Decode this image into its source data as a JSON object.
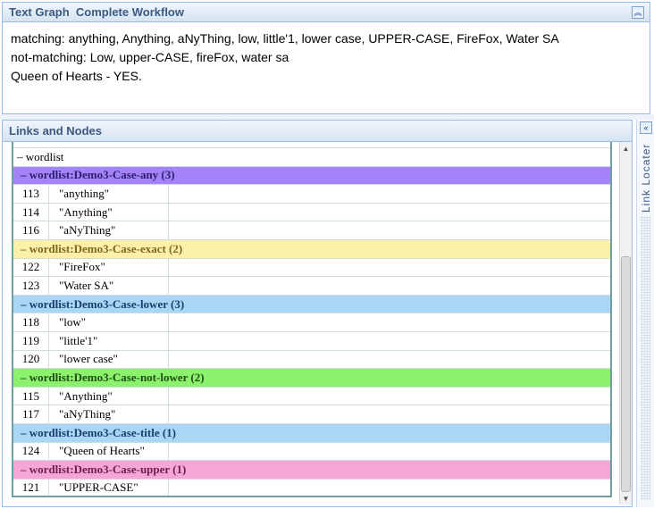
{
  "top_panel": {
    "title": "Text Graph  Complete Workflow",
    "lines": [
      "matching: anything, Anything, aNyThing, low, little'1, lower case, UPPER-CASE, FireFox, Water SA",
      "not-matching: Low, upper-CASE, fireFox, water sa",
      "Queen of Hearts - YES."
    ]
  },
  "links_panel": {
    "title": "Links and Nodes",
    "root_label": "– wordlist",
    "groups": [
      {
        "label": "– wordlist:Demo3-Case-any (3)",
        "color": "#a383f7",
        "text_color": "#2b1f6e",
        "items": [
          {
            "id": "113",
            "text": "\"anything\""
          },
          {
            "id": "114",
            "text": "\"Anything\""
          },
          {
            "id": "116",
            "text": "\"aNyThing\""
          }
        ]
      },
      {
        "label": "– wordlist:Demo3-Case-exact (2)",
        "color": "#fdf0a8",
        "text_color": "#7a6a1a",
        "items": [
          {
            "id": "122",
            "text": "\"FireFox\""
          },
          {
            "id": "123",
            "text": "\"Water SA\""
          }
        ]
      },
      {
        "label": "– wordlist:Demo3-Case-lower (3)",
        "color": "#a9d6f5",
        "text_color": "#1c3f6e",
        "items": [
          {
            "id": "118",
            "text": "\"low\""
          },
          {
            "id": "119",
            "text": "\"little'1\""
          },
          {
            "id": "120",
            "text": "\"lower case\""
          }
        ]
      },
      {
        "label": "– wordlist:Demo3-Case-not-lower (2)",
        "color": "#8cf26e",
        "text_color": "#1f4d12",
        "items": [
          {
            "id": "115",
            "text": "\"Anything\""
          },
          {
            "id": "117",
            "text": "\"aNyThing\""
          }
        ]
      },
      {
        "label": "– wordlist:Demo3-Case-title (1)",
        "color": "#a9d6f5",
        "text_color": "#1c3f6e",
        "items": [
          {
            "id": "124",
            "text": "\"Queen of Hearts\""
          }
        ]
      },
      {
        "label": "– wordlist:Demo3-Case-upper (1)",
        "color": "#f5a6d9",
        "text_color": "#6e1f52",
        "items": [
          {
            "id": "121",
            "text": "\"UPPER-CASE\""
          }
        ]
      }
    ]
  },
  "link_locator": {
    "label": "Link Locater"
  },
  "icons": {
    "collapse_up": "collapse-up-icon",
    "collapse_right": "collapse-right-icon",
    "scroll_up": "scroll-up-icon",
    "scroll_down": "scroll-down-icon"
  }
}
